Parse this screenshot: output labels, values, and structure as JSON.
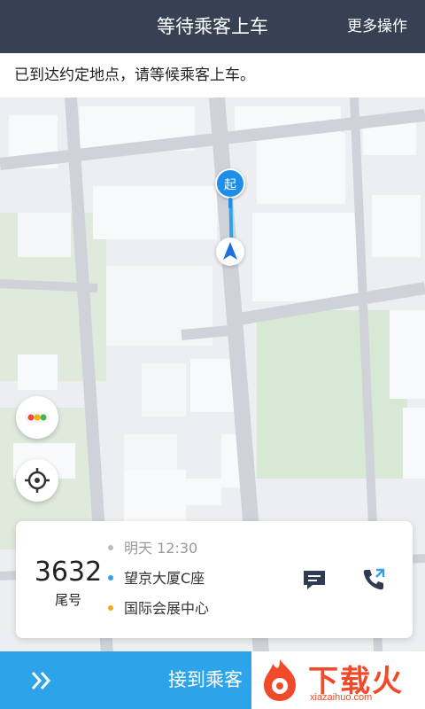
{
  "header": {
    "title": "等待乘客上车",
    "more_label": "更多操作"
  },
  "notice": {
    "text": "已到达约定地点，请等候乘客上车。"
  },
  "map": {
    "pickup_marker_label": "起"
  },
  "trip_card": {
    "tail_number": "3632",
    "tail_label": "尾号",
    "time": "明天 12:30",
    "pickup": "望京大厦C座",
    "destination": "国际会展中心",
    "colors": {
      "time_dot": "#bbbbbb",
      "pickup_dot": "#2da4ea",
      "destination_dot": "#f5a623"
    }
  },
  "bottom_bar": {
    "action_label": "接到乘客"
  },
  "watermark": {
    "title": "下载火",
    "domain": "xiazaihuo.com"
  },
  "icons": {
    "traffic": "traffic-light-icon",
    "locate": "locate-icon",
    "message": "message-icon",
    "phone": "phone-icon",
    "chevron": "double-chevron-right-icon",
    "nav": "navigation-arrow-icon"
  },
  "colors": {
    "header_bg": "#384053",
    "accent": "#2da4ea",
    "brand_orange": "#f04a2a"
  }
}
